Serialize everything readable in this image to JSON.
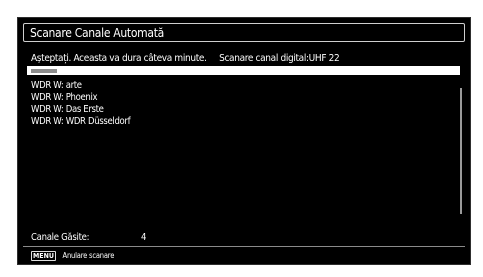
{
  "dialog": {
    "title": "Scanare Canale Automată",
    "status_wait": "Așteptați. Aceasta va dura câteva minute.",
    "status_scan": "Scanare canal digital:UHF 22",
    "progress": 0.06
  },
  "channels": [
    "WDR W: arte",
    "WDR W: Phoenix",
    "WDR W: Das Erste",
    "WDR W: WDR Düsseldorf"
  ],
  "found": {
    "label": "Canale Găsite:",
    "count": "4"
  },
  "footer": {
    "key": "MENU",
    "label": "Anulare scanare"
  },
  "colors": {
    "background": "#000000",
    "text": "#ffffff",
    "progress_track": "#ffffff",
    "progress_fill": "#8c8c8c"
  }
}
